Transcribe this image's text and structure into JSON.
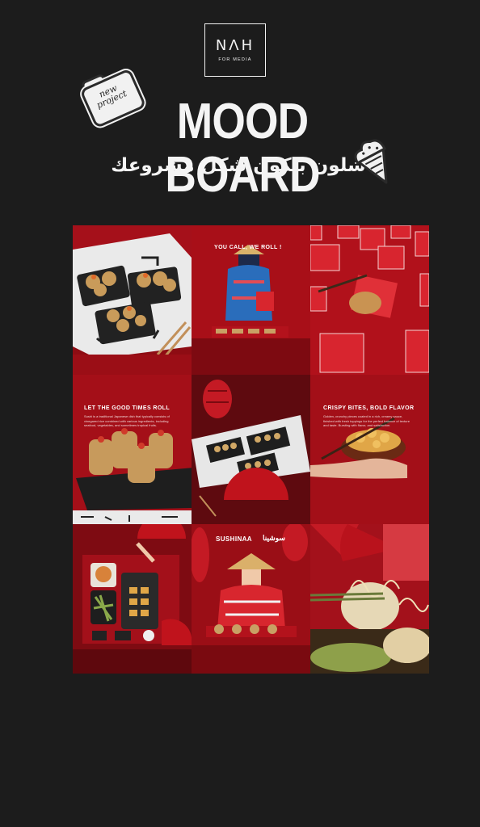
{
  "header": {
    "logo_mark": "NΛH",
    "logo_sub": "FOR MEDIA",
    "sticker_text_1": "new",
    "sticker_text_2": "project",
    "title": "MOOD BOARD",
    "subtitle": "شلون بيكون شكل مشروعك"
  },
  "board": {
    "tiles": [
      {
        "id": "tile-1",
        "caption": ""
      },
      {
        "id": "tile-2",
        "caption": "YOU CALL, WE ROLL !"
      },
      {
        "id": "tile-3",
        "caption": ""
      },
      {
        "id": "tile-4",
        "caption": "LET THE GOOD TIMES ROLL",
        "body": "Sushi is a traditional Japanese dish that typically consists of vinegared rice combined with various ingredients, including seafood, vegetables, and sometimes tropical fruits."
      },
      {
        "id": "tile-5",
        "caption": ""
      },
      {
        "id": "tile-6",
        "caption": "CRISPY BITES, BOLD FLAVOR",
        "body": "Golden, crunchy pieces coated in a rich, creamy sauce, finished with fresh toppings for the perfect balance of texture and taste. Bursting with flavor, and satisfaction."
      },
      {
        "id": "tile-7",
        "caption": ""
      },
      {
        "id": "tile-8",
        "caption": "SUSHINAA",
        "caption_ar": "سوشينا"
      },
      {
        "id": "tile-9",
        "caption": ""
      }
    ]
  },
  "colors": {
    "background": "#1c1c1c",
    "brand_red": "#b3121c",
    "text": "#f4f4f4"
  }
}
